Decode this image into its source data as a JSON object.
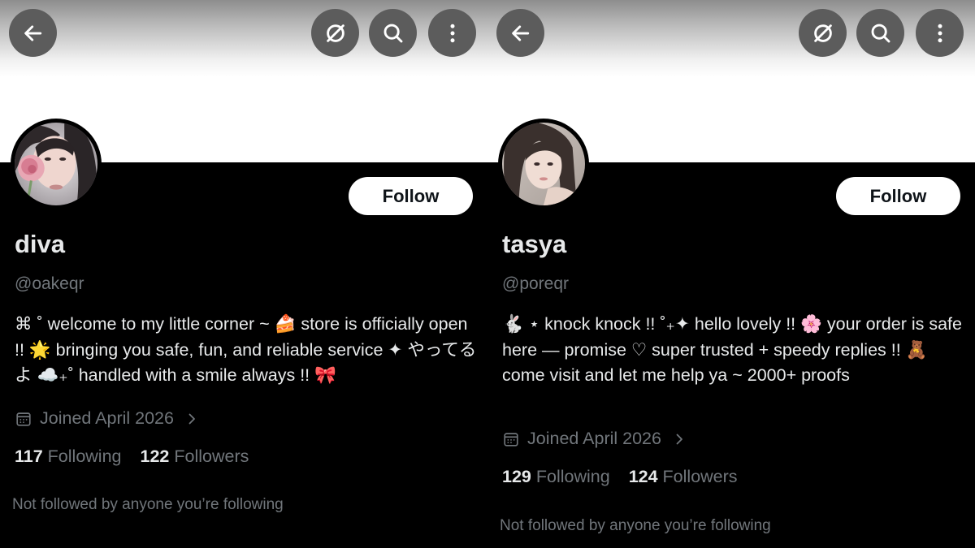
{
  "profiles": [
    {
      "display_name": "diva",
      "handle": "@oakeqr",
      "follow_label": "Follow",
      "bio": "⌘ ˚ welcome to my little corner ~ 🍰 store is officially open !! 🌟 bringing you safe, fun, and reliable service ✦ やってるよ ☁️₊˚ handled with a smile always !! 🎀",
      "joined": "Joined April 2026",
      "following_count": "117",
      "following_label": "Following",
      "followers_count": "122",
      "followers_label": "Followers",
      "not_followed": "Not followed by anyone you’re following"
    },
    {
      "display_name": "tasya",
      "handle": "@poreqr",
      "follow_label": "Follow",
      "bio": "🐇 ⋆ knock knock !! ˚₊✦ hello lovely !! 🌸 your order is safe here — promise ♡ super trusted + speedy replies !! 🧸 come visit and let me help ya ~ 2000+ proofs",
      "joined": "Joined April 2026",
      "following_count": "129",
      "following_label": "Following",
      "followers_count": "124",
      "followers_label": "Followers",
      "not_followed": "Not followed by anyone you’re following"
    }
  ],
  "icons": {
    "back": "arrow-left-icon",
    "grok": "grok-icon",
    "search": "search-icon",
    "more": "more-vertical-icon",
    "calendar": "calendar-icon",
    "chevron": "chevron-right-icon"
  },
  "colors": {
    "background": "#000000",
    "text_primary": "#e7e9ea",
    "text_secondary": "#71767b",
    "nav_button": "#5c5c5c",
    "follow_button": "#ffffff"
  }
}
